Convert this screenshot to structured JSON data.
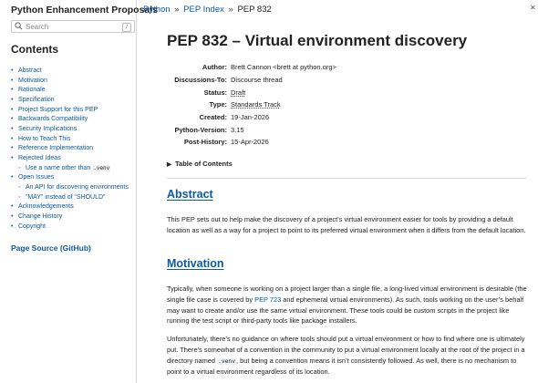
{
  "sidebar": {
    "site_title": "Python Enhancement Proposals",
    "search_placeholder": "Search",
    "search_shortcut": "/",
    "contents_heading": "Contents",
    "toc": [
      {
        "label": "Abstract",
        "level": 1
      },
      {
        "label": "Motivation",
        "level": 1
      },
      {
        "label": "Rationale",
        "level": 1
      },
      {
        "label": "Specification",
        "level": 1
      },
      {
        "label": "Project Support for this PEP",
        "level": 1
      },
      {
        "label": "Backwards Compatibility",
        "level": 1
      },
      {
        "label": "Security Implications",
        "level": 1
      },
      {
        "label": "How to Teach This",
        "level": 1
      },
      {
        "label": "Reference Implementation",
        "level": 1
      },
      {
        "label": "Rejected Ideas",
        "level": 1
      },
      {
        "label": "Use a name other than",
        "code": ".venv",
        "level": 2
      },
      {
        "label": "Open Issues",
        "level": 1
      },
      {
        "label": "An API for discovering environments",
        "level": 2
      },
      {
        "label": "“MAY” instead of “SHOULD”",
        "level": 2
      },
      {
        "label": "Acknowledgements",
        "level": 1
      },
      {
        "label": "Change History",
        "level": 1
      },
      {
        "label": "Copyright",
        "level": 1
      }
    ],
    "page_source": "Page Source (GitHub)"
  },
  "breadcrumb": {
    "python": "Python",
    "sep1": "»",
    "pep_index": "PEP Index",
    "sep2": "»",
    "current": "PEP 832"
  },
  "pep": {
    "title": "PEP 832 – Virtual environment discovery",
    "meta": {
      "author_key": "Author:",
      "author": "Brett Cannon <brett at python.org>",
      "discussions_key": "Discussions-To:",
      "discussions": "Discourse thread",
      "status_key": "Status:",
      "status": "Draft",
      "type_key": "Type:",
      "type": "Standards Track",
      "created_key": "Created:",
      "created": "19-Jan-2026",
      "pyver_key": "Python-Version:",
      "pyver": "3.15",
      "post_history_key": "Post-History:",
      "post_history": "15-Apr-2026"
    },
    "toc_toggle": "Table of Contents"
  },
  "abstract": {
    "heading": "Abstract",
    "text": "This PEP sets out to help make the discovery of a project’s virtual environment easier for tools by providing a default location as well as a way for a project to point to its preferred virtual environment when it differs from the default location."
  },
  "motivation": {
    "heading": "Motivation",
    "p1_a": "Typically, when someone is working on a project larger than a single file, a long-lived virtual environment is desirable (the single file case is covered by ",
    "p1_link": "PEP 723",
    "p1_b": " and ephemeral virtual environments). As such, tools working on the user’s behalf may want to create and/or use the same virtual environment. These tools could be custom scripts in the project like running the test script or third-party tools like package installers.",
    "p2_a": "Unfortunately, there’s no guidance on where tools should put a virtual environment or how to find where one is ultimately put. There’s somewhat of a convention in the community to put a virtual environment locally at the root of the project in a directory named ",
    "p2_code": ".venv",
    "p2_b": ", but being a convention means it isn’t consistently followed. As well, there is no mechanism to point to a virtual environment regardless of its location."
  }
}
